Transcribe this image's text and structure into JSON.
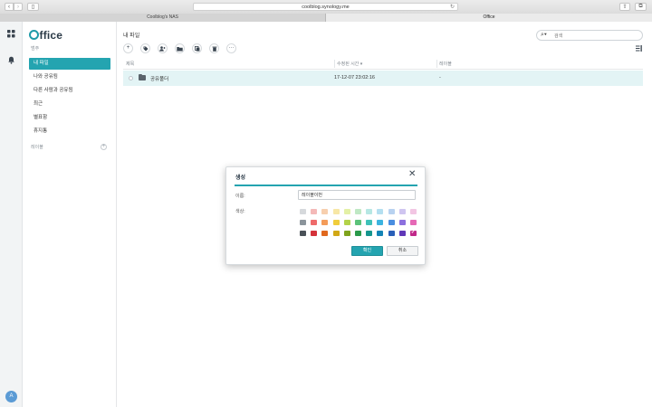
{
  "browser": {
    "url": "coolblog.synology.me",
    "tabs": [
      {
        "label": "Coolblog's NAS",
        "active": false
      },
      {
        "label": "Office",
        "active": true
      }
    ]
  },
  "rail": {
    "avatar_letter": "A"
  },
  "sidebar": {
    "logo_text": "ffice",
    "category_label": "범주",
    "items": [
      {
        "label": "내 파일",
        "active": true
      },
      {
        "label": "나와 공유됨",
        "active": false
      },
      {
        "label": "다른 사람과 공유됨",
        "active": false
      },
      {
        "label": "최근",
        "active": false
      },
      {
        "label": "별표함",
        "active": false
      },
      {
        "label": "휴지통",
        "active": false
      }
    ],
    "label_section": "레이블",
    "add_label_symbol": "+"
  },
  "main": {
    "title": "내 파일",
    "search_placeholder": "검색",
    "table": {
      "columns": [
        "제목",
        "수정된 시간 ▾",
        "레이블"
      ],
      "rows": [
        {
          "name": "공유폴더",
          "modified": "17-12-07 23:02:16",
          "label": "-"
        }
      ]
    }
  },
  "dialog": {
    "title": "생성",
    "name_label": "이름:",
    "name_value": "레이블이번",
    "color_label": "색상:",
    "colors": [
      [
        "#d6d9dc",
        "#f4b9b8",
        "#f7cfae",
        "#f7e7a6",
        "#e3f0a6",
        "#bfe8c4",
        "#b6e7e3",
        "#b4dff0",
        "#b8d2f0",
        "#cfc5f0",
        "#f2c6e3"
      ],
      [
        "#8b949b",
        "#ee6b6b",
        "#f49c5a",
        "#f0cd3c",
        "#b3d24a",
        "#5cc27a",
        "#3fc1b8",
        "#3cb4e0",
        "#4a8ee0",
        "#8c70de",
        "#e569b6"
      ],
      [
        "#4a5158",
        "#d4323a",
        "#e0681e",
        "#d1a816",
        "#7fa31d",
        "#2b9a4a",
        "#15968e",
        "#1484b6",
        "#2a60b8",
        "#6038b8",
        "#c1298a"
      ]
    ],
    "selected_color": "#c1298a",
    "ok_label": "확인",
    "cancel_label": "취소"
  }
}
